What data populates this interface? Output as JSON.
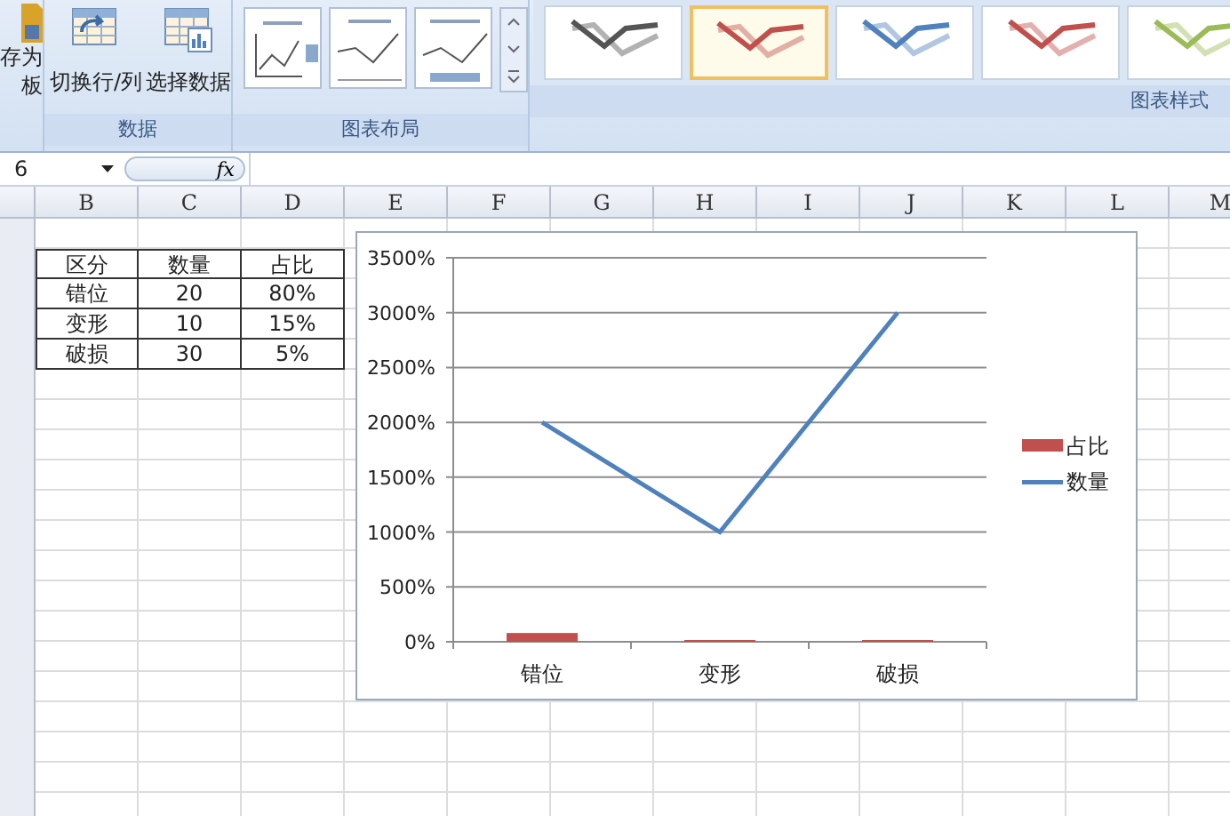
{
  "ribbon": {
    "partial_button": {
      "lines": [
        "存为",
        "板"
      ]
    },
    "groups": [
      {
        "kind": "data",
        "label": "数据",
        "buttons": [
          "切换行/列",
          "选择数据"
        ]
      },
      {
        "kind": "layouts",
        "label": "图表布局",
        "items": [
          {
            "kind": "legend"
          },
          {
            "kind": "labels"
          },
          {
            "kind": "table"
          }
        ]
      },
      {
        "kind": "styles",
        "label": "图表样式",
        "items": [
          {
            "color": "#555555",
            "selected": false
          },
          {
            "color": "#c0504d",
            "selected": true
          },
          {
            "color": "#4f81bd",
            "selected": false
          },
          {
            "color": "#c0504d",
            "selected": false
          },
          {
            "color": "#9bbb59",
            "selected": false
          }
        ]
      }
    ]
  },
  "formula_bar": {
    "name_box": "6",
    "fx": "fx"
  },
  "sheet": {
    "columns": [
      "B",
      "C",
      "D",
      "E",
      "F",
      "G",
      "H",
      "I",
      "J",
      "K",
      "L",
      "M"
    ],
    "table": {
      "header": [
        "区分",
        "数量",
        "占比"
      ],
      "rows": [
        [
          "错位",
          "20",
          "80%"
        ],
        [
          "变形",
          "10",
          "15%"
        ],
        [
          "破损",
          "30",
          "5%"
        ]
      ]
    },
    "chart": {
      "chart_data": {
        "type": "line",
        "categories": [
          "错位",
          "变形",
          "破损"
        ],
        "ylim": [
          0,
          3500
        ],
        "grid": true,
        "legend": true,
        "yticks": [
          {
            "value": 0,
            "label": "0%"
          },
          {
            "value": 500,
            "label": "500%"
          },
          {
            "value": 1000,
            "label": "1000%"
          },
          {
            "value": 1500,
            "label": "1500%"
          },
          {
            "value": 2000,
            "label": "2000%"
          },
          {
            "value": 2500,
            "label": "2500%"
          },
          {
            "value": 3000,
            "label": "3000%"
          },
          {
            "value": 3500,
            "label": "3500%"
          }
        ],
        "series": [
          {
            "name": "占比",
            "type": "bar",
            "color": "#c0504d",
            "values": [
              80,
              15,
              5
            ]
          },
          {
            "name": "数量",
            "color": "#4f81bd",
            "values": [
              2000,
              1000,
              3000
            ]
          }
        ]
      }
    }
  }
}
